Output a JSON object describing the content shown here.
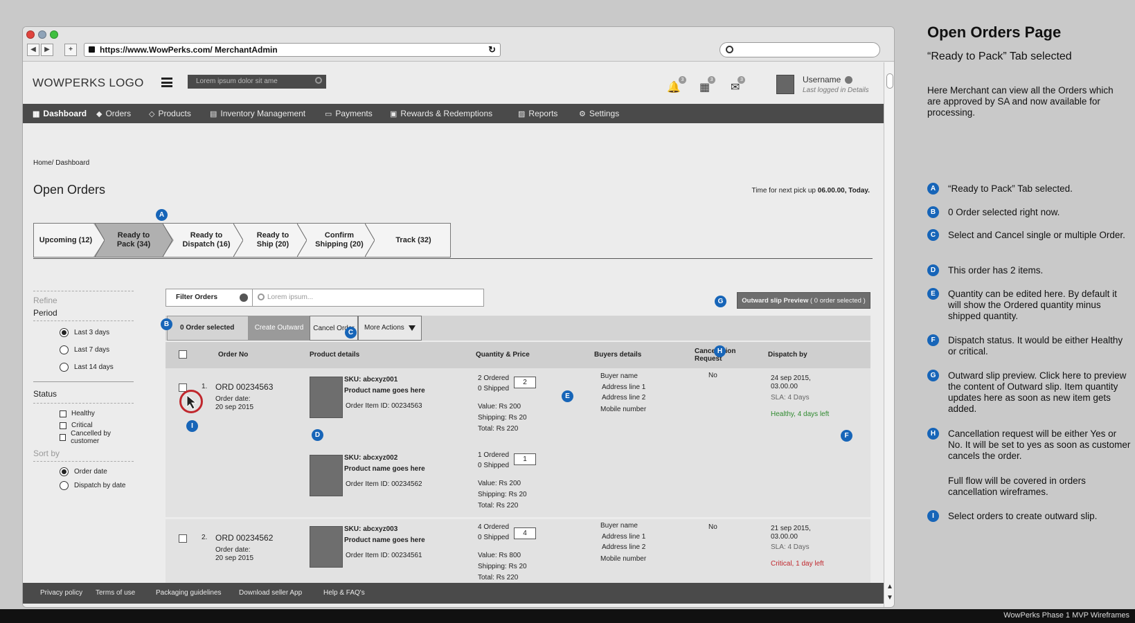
{
  "browser": {
    "url": "https://www.WowPerks.com/ MerchantAdmin",
    "back": "◀",
    "forward": "▶",
    "new_tab": "+",
    "reload": "↻"
  },
  "header": {
    "logo": "WOWPERKS LOGO",
    "search_placeholder": "Lorem ipsum dolor sit ame",
    "badge_count": "3",
    "username": "Username",
    "last_logged": "Last logged in Details"
  },
  "nav": {
    "items": [
      "Dashboard",
      "Orders",
      "Products",
      "Inventory Management",
      "Payments",
      "Rewards & Redemptions",
      "Reports",
      "Settings"
    ]
  },
  "page": {
    "breadcrumb": "Home/ Dashboard",
    "title": "Open Orders",
    "pickup_prefix": "Time for next pick up ",
    "pickup_time": "06.00.00, Today."
  },
  "tabs": [
    {
      "label": "Upcoming (12)"
    },
    {
      "label": "Ready to\nPack (34)"
    },
    {
      "label": "Ready to\nDispatch (16)"
    },
    {
      "label": "Ready to\nShip (20)"
    },
    {
      "label": "Confirm\nShipping (20)"
    },
    {
      "label": "Track (32)"
    }
  ],
  "sidebar": {
    "refine": "Refine",
    "period_label": "Period",
    "period_options": [
      "Last 3 days",
      "Last 7 days",
      "Last 14 days"
    ],
    "status_label": "Status",
    "status_options": [
      "Healthy",
      "Critical",
      "Cancelled by customer"
    ],
    "sort_label": "Sort by",
    "sort_options": [
      "Order date",
      "Dispatch by date"
    ]
  },
  "toolbar": {
    "filter_label": "Filter Orders",
    "filter_placeholder": "Lorem ipsum...",
    "outward_preview": "Outward slip Preview",
    "outward_count": " ( 0 order selected )",
    "selected_count": "0 Order selected",
    "create_outward": "Create Outward",
    "cancel_order": "Cancel Order",
    "more_actions": "More Actions"
  },
  "table": {
    "headers": [
      "Order No",
      "Product details",
      "Quantity & Price",
      "Buyers details",
      "Cancellation\nRequest",
      "Dispatch by"
    ],
    "orders": [
      {
        "index": "1.",
        "order_no": "ORD 00234563",
        "order_date_label": "Order date:",
        "order_date": "20 sep 2015",
        "items": [
          {
            "sku": "SKU: abcxyz001",
            "product": "Product name goes here",
            "item_id": "Order Item ID: 00234563",
            "ordered": "2 Ordered",
            "shipped": "0 Shipped",
            "qty": "2",
            "value": "Value: Rs 200",
            "shipping": "Shipping: Rs 20",
            "total": "Total: Rs 220"
          },
          {
            "sku": "SKU: abcxyz002",
            "product": "Product name goes here",
            "item_id": "Order Item ID: 00234562",
            "ordered": "1 Ordered",
            "shipped": "0 Shipped",
            "qty": "1",
            "value": "Value: Rs 200",
            "shipping": "Shipping: Rs 20",
            "total": "Total: Rs 220"
          }
        ],
        "buyer": [
          "Buyer name",
          "Address line 1",
          "Address line 2",
          "Mobile number"
        ],
        "cancellation": "No",
        "dispatch_date": "24 sep 2015,\n03.00.00",
        "sla": "SLA: 4 Days",
        "status": "Healthy, 4 days left"
      },
      {
        "index": "2.",
        "order_no": "ORD 00234562",
        "order_date_label": "Order date:",
        "order_date": "20 sep 2015",
        "items": [
          {
            "sku": "SKU: abcxyz003",
            "product": "Product name goes here",
            "item_id": "Order Item ID: 00234561",
            "ordered": "4 Ordered",
            "shipped": "0 Shipped",
            "qty": "4",
            "value": "Value: Rs 800",
            "shipping": "Shipping: Rs 20",
            "total": "Total: Rs 220"
          }
        ],
        "buyer": [
          "Buyer name",
          "Address line 1",
          "Address line 2",
          "Mobile number"
        ],
        "cancellation": "No",
        "dispatch_date": "21 sep 2015,\n03.00.00",
        "sla": "SLA: 4 Days",
        "status": "Critical, 1 day left"
      }
    ]
  },
  "footer": {
    "links": [
      "Privacy policy",
      "Terms of use",
      "Packaging guidelines",
      "Download seller App",
      "Help & FAQ's"
    ]
  },
  "markers": {
    "A": "A",
    "B": "B",
    "C": "C",
    "D": "D",
    "E": "E",
    "F": "F",
    "G": "G",
    "H": "H",
    "I": "I"
  },
  "notes": {
    "title": "Open Orders Page",
    "subtitle": "“Ready to Pack” Tab selected",
    "description": "Here Merchant can view all the Orders which are approved by SA and now available for processing.",
    "items": [
      {
        "marker": "A",
        "text": "“Ready to Pack” Tab selected."
      },
      {
        "marker": "B",
        "text": "0 Order selected right now."
      },
      {
        "marker": "C",
        "text": "Select and Cancel single or multiple Order."
      },
      {
        "marker": "D",
        "text": "This order has 2 items."
      },
      {
        "marker": "E",
        "text": "Quantity can be edited here. By default it will show the Ordered quantity minus shipped quantity."
      },
      {
        "marker": "F",
        "text": "Dispatch status. It would be either Healthy or critical."
      },
      {
        "marker": "G",
        "text": "Outward slip preview. Click here to preview the content of Outward slip. Item quantity updates here as soon as new item gets added."
      },
      {
        "marker": "H",
        "text": "Cancellation request will be either Yes or No. It will be set to yes as soon as customer cancels the order."
      },
      {
        "marker": "I",
        "text": "Select orders to create outward slip."
      }
    ],
    "extra": "Full flow will be covered in orders cancellation wireframes."
  },
  "deck_footer": "WowPerks Phase 1 MVP Wireframes",
  "colors": {
    "accent": "#1765b8",
    "nav_bg": "#4a4a4a",
    "healthy": "#2f8a2f",
    "critical": "#c0272d"
  }
}
